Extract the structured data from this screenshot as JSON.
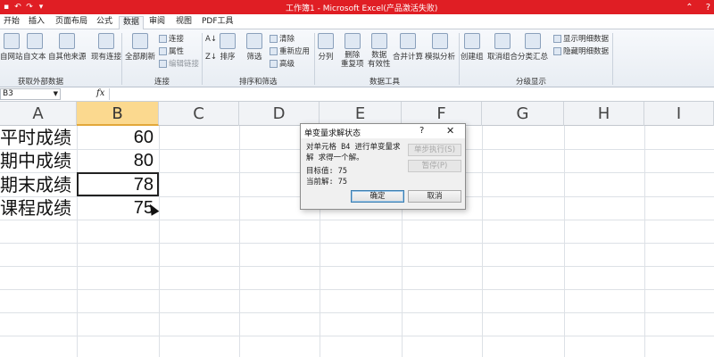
{
  "titlebar": {
    "title": "工作簿1 - Microsoft Excel(产品激活失败)",
    "qat_icons": [
      "save-icon",
      "undo-icon",
      "redo-icon",
      "customize-icon"
    ],
    "controls": [
      "minimize-icon",
      "help-icon",
      "close-icon"
    ]
  },
  "tabs": [
    {
      "label": "开始"
    },
    {
      "label": "插入"
    },
    {
      "label": "页面布局"
    },
    {
      "label": "公式"
    },
    {
      "label": "数据",
      "active": true
    },
    {
      "label": "审阅"
    },
    {
      "label": "视图"
    },
    {
      "label": "PDF工具"
    }
  ],
  "ribbon": {
    "groups": [
      {
        "label": "获取外部数据",
        "buttons": [
          "自网站",
          "自文本",
          "自其他来源",
          "现有连接"
        ]
      },
      {
        "label": "连接",
        "buttons": [
          "全部刷新",
          "连接",
          "属性",
          "编辑链接"
        ]
      },
      {
        "label": "排序和筛选",
        "buttons": [
          "排序",
          "筛选",
          "清除",
          "重新应用",
          "高级"
        ]
      },
      {
        "label": "数据工具",
        "buttons": [
          "分列",
          "删除\n重复项",
          "数据\n有效性",
          "合并计算",
          "模拟分析"
        ]
      },
      {
        "label": "分级显示",
        "buttons": [
          "创建组",
          "取消组合",
          "分类汇总",
          "显示明细数据",
          "隐藏明细数据"
        ]
      }
    ]
  },
  "formula_bar": {
    "name_box": "B3",
    "fx": "fx",
    "value": ""
  },
  "columns": [
    "A",
    "B",
    "C",
    "D",
    "E",
    "F",
    "G",
    "H",
    "I"
  ],
  "selected_column": "B",
  "rows": [
    {
      "label": "平时成绩",
      "value": "60"
    },
    {
      "label": "期中成绩",
      "value": "80"
    },
    {
      "label": "期末成绩",
      "value": "78"
    },
    {
      "label": "课程成绩",
      "value": "75"
    }
  ],
  "dialog": {
    "title": "单变量求解状态",
    "help": "?",
    "close": "✕",
    "message": "对单元格 B4 进行单变量求解 求得一个解。",
    "target_label": "目标值:",
    "target_value": "75",
    "current_label": "当前解:",
    "current_value": "75",
    "btn_step": "单步执行(S)",
    "btn_pause": "暂停(P)",
    "btn_ok": "确定",
    "btn_cancel": "取消"
  }
}
